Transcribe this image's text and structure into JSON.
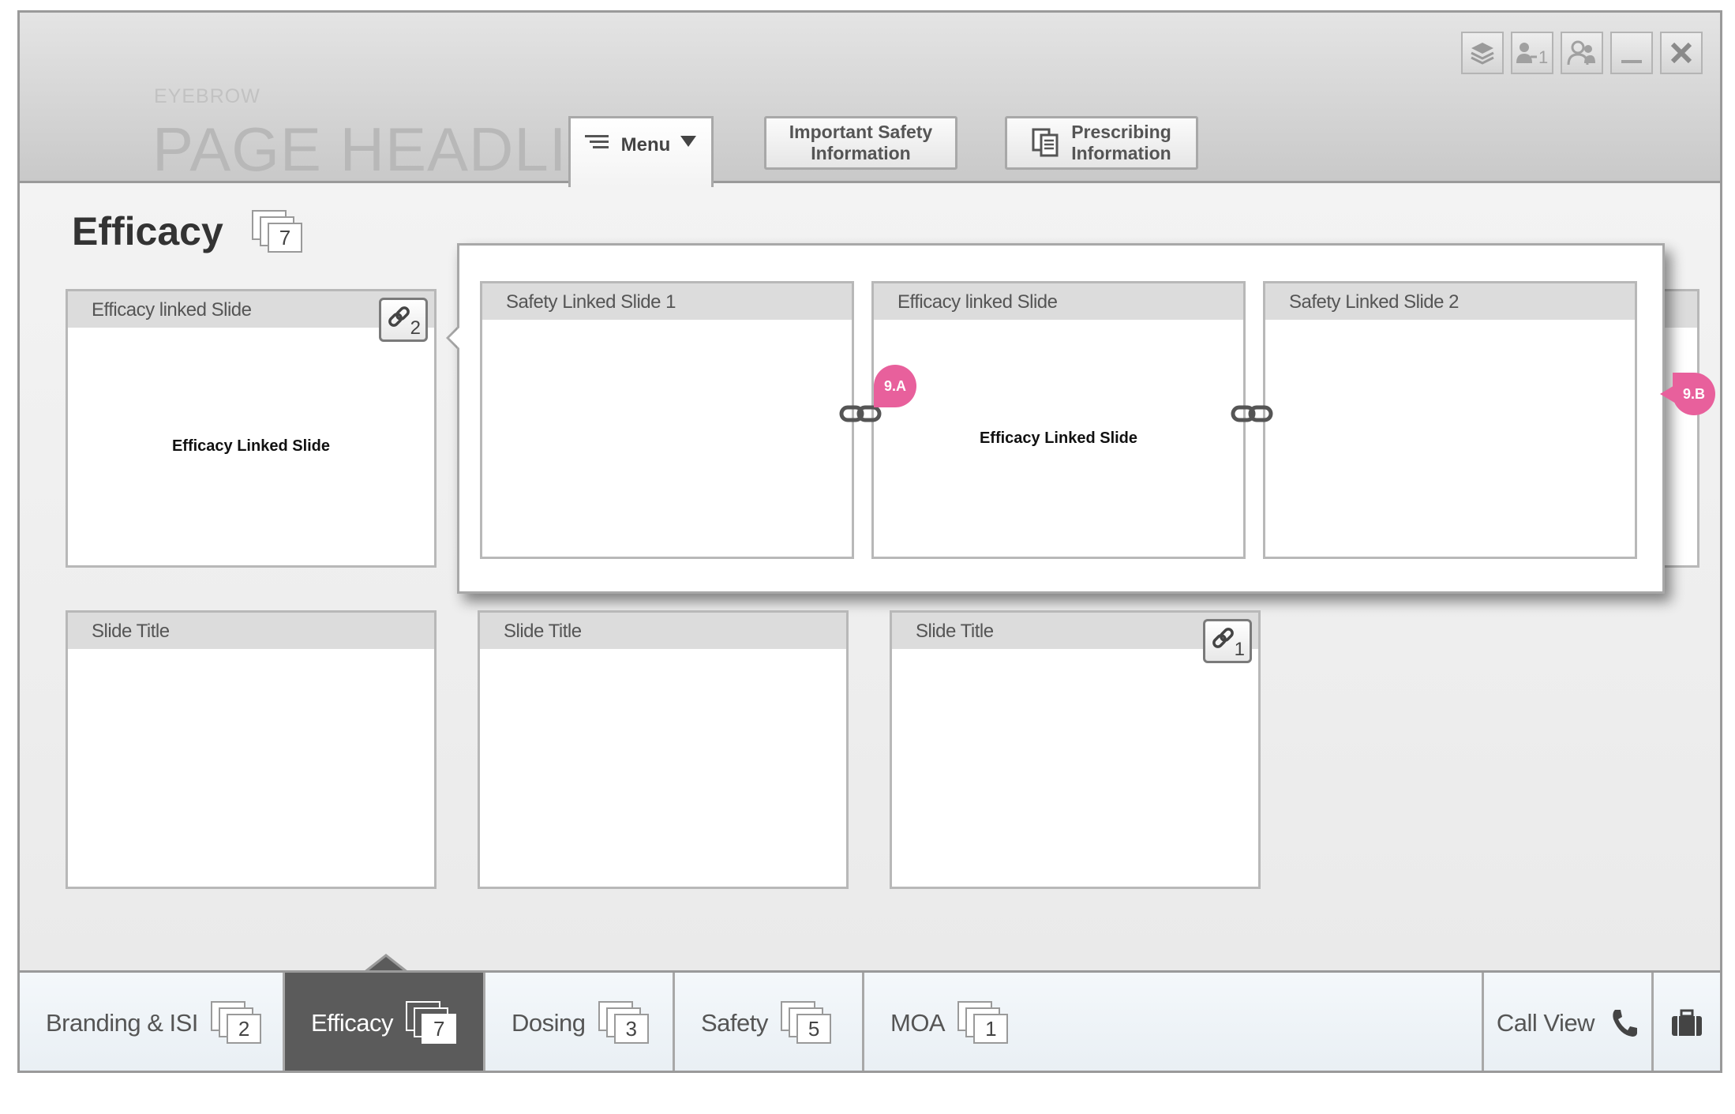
{
  "header": {
    "eyebrow": "EYEBROW",
    "headline": "PAGE HEADLINES",
    "menu_label": "Menu",
    "isi_label_line1": "Important Safety",
    "isi_label_line2": "Information",
    "pi_label_line1": "Prescribing",
    "pi_label_line2": "Information",
    "window_controls": [
      "layers-icon",
      "share-user-icon",
      "users-icon",
      "minimize-icon",
      "close-icon"
    ],
    "share_count": "1"
  },
  "section": {
    "title": "Efficacy",
    "slide_count": "7"
  },
  "grid": {
    "row1": [
      {
        "title": "Efficacy linked Slide",
        "body": "Efficacy Linked Slide",
        "link_count": "2"
      }
    ],
    "row2": [
      {
        "title": "Slide Title"
      },
      {
        "title": "Slide Title"
      },
      {
        "title": "Slide Title",
        "link_count": "1"
      }
    ]
  },
  "popup": {
    "slides": [
      {
        "title": "Safety Linked Slide 1",
        "body": ""
      },
      {
        "title": "Efficacy linked Slide",
        "body": "Efficacy Linked Slide"
      },
      {
        "title": "Safety Linked Slide 2",
        "body": ""
      }
    ],
    "annotation_a": "9.A",
    "annotation_b": "9.B"
  },
  "bottom_nav": {
    "items": [
      {
        "label": "Branding & ISI",
        "count": "2"
      },
      {
        "label": "Efficacy",
        "count": "7",
        "active": true
      },
      {
        "label": "Dosing",
        "count": "3"
      },
      {
        "label": "Safety",
        "count": "5"
      },
      {
        "label": "MOA",
        "count": "1"
      }
    ],
    "call_view": "Call View"
  },
  "colors": {
    "annotation_pink": "#e8609c",
    "active_tab": "#5b5b5b"
  }
}
